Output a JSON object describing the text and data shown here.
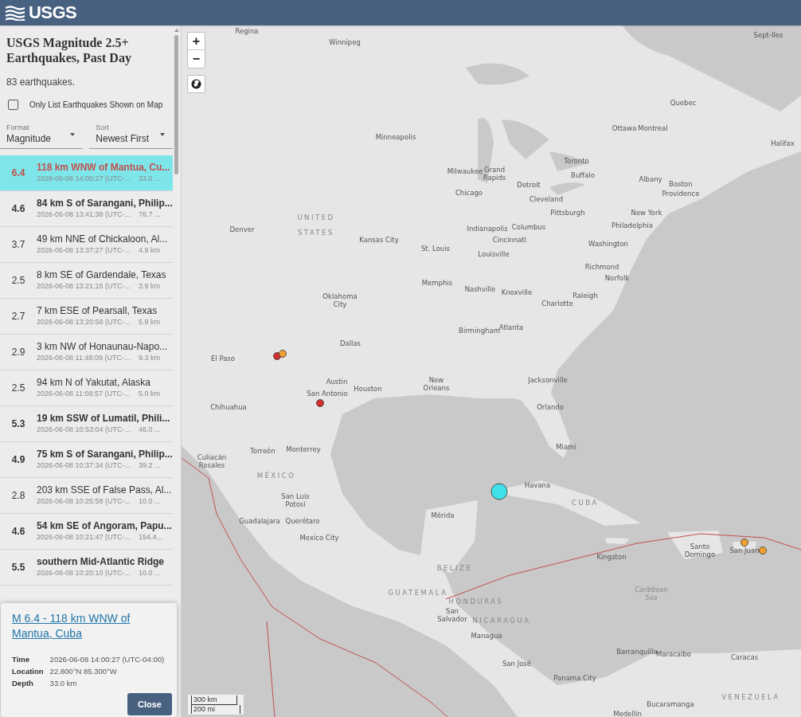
{
  "header": {
    "logo": "USGS"
  },
  "sidebar": {
    "title": "USGS Magnitude 2.5+ Earthquakes, Past Day",
    "count": "83 earthquakes.",
    "filter": {
      "label": "Only List Earthquakes Shown on Map",
      "checked": false
    },
    "selects": [
      {
        "label": "Format",
        "value": "Magnitude"
      },
      {
        "label": "Sort",
        "value": "Newest First"
      }
    ],
    "events": [
      {
        "mag": "6.4",
        "place": "118 km WNW of Mantua, Cu...",
        "time": "2026-06-08 14:00:27 (UTC-...",
        "depth": "33.0 ...",
        "significant": true,
        "selected": true
      },
      {
        "mag": "4.6",
        "place": "84 km S of Sarangani, Philip...",
        "time": "2026-06-08 13:41:38 (UTC-...",
        "depth": "76.7 ...",
        "significant": true,
        "selected": false
      },
      {
        "mag": "3.7",
        "place": "49 km NNE of Chickaloon, Al...",
        "time": "2026-06-08 13:37:27 (UTC-...",
        "depth": "4.9 km",
        "significant": false,
        "selected": false
      },
      {
        "mag": "2.5",
        "place": "8 km SE of Gardendale, Texas",
        "time": "2026-06-08 13:21:15 (UTC-...",
        "depth": "3.9 km",
        "significant": false,
        "selected": false
      },
      {
        "mag": "2.7",
        "place": "7 km ESE of Pearsall, Texas",
        "time": "2026-06-08 13:20:58 (UTC-...",
        "depth": "5.9 km",
        "significant": false,
        "selected": false
      },
      {
        "mag": "2.9",
        "place": "3 km NW of Honaunau-Napo...",
        "time": "2026-06-08 11:48:09 (UTC-...",
        "depth": "9.3 km",
        "significant": false,
        "selected": false
      },
      {
        "mag": "2.5",
        "place": "94 km N of Yakutat, Alaska",
        "time": "2026-06-08 11:08:57 (UTC-...",
        "depth": "5.0 km",
        "significant": false,
        "selected": false
      },
      {
        "mag": "5.3",
        "place": "19 km SSW of Lumatil, Phili...",
        "time": "2026-06-08 10:53:04 (UTC-...",
        "depth": "46.0 ...",
        "significant": true,
        "selected": false
      },
      {
        "mag": "4.9",
        "place": "75 km S of Sarangani, Philip...",
        "time": "2026-06-08 10:37:34 (UTC-...",
        "depth": "39.2 ...",
        "significant": true,
        "selected": false
      },
      {
        "mag": "2.8",
        "place": "203 km SSE of False Pass, Al...",
        "time": "2026-06-08 10:25:58 (UTC-...",
        "depth": "10.0 ...",
        "significant": false,
        "selected": false
      },
      {
        "mag": "4.6",
        "place": "54 km SE of Angoram, Papu...",
        "time": "2026-06-08 10:21:47 (UTC-...",
        "depth": "154.4...",
        "significant": true,
        "selected": false
      },
      {
        "mag": "5.5",
        "place": "southern Mid-Atlantic Ridge",
        "time": "2026-06-08 10:20:10 (UTC-...",
        "depth": "10.0 ...",
        "significant": true,
        "selected": false
      }
    ]
  },
  "popup": {
    "title": "M 6.4 - 118 km WNW of Mantua, Cuba",
    "fields": [
      {
        "label": "Time",
        "value": "2026-06-08 14:00:27 (UTC-04:00)"
      },
      {
        "label": "Location",
        "value": "22.800°N 85.300°W"
      },
      {
        "label": "Depth",
        "value": "33.0 km"
      }
    ],
    "button": "Close"
  },
  "map": {
    "zoom_in": "+",
    "zoom_out": "−",
    "labels": [
      {
        "text": "Regina",
        "kind": "city"
      },
      {
        "text": "Winnipeg",
        "kind": "city"
      },
      {
        "text": "Sept-Iles",
        "kind": "city"
      },
      {
        "text": "Quebec",
        "kind": "city"
      },
      {
        "text": "Ottawa",
        "kind": "city"
      },
      {
        "text": "Montreal",
        "kind": "city"
      },
      {
        "text": "Halifax",
        "kind": "city"
      },
      {
        "text": "Minneapolis",
        "kind": "city"
      },
      {
        "text": "Toronto",
        "kind": "city"
      },
      {
        "text": "Milwaukee",
        "kind": "city"
      },
      {
        "text": "Grand",
        "kind": "city"
      },
      {
        "text": "Rapids",
        "kind": "city"
      },
      {
        "text": "Buffalo",
        "kind": "city"
      },
      {
        "text": "Albany",
        "kind": "city"
      },
      {
        "text": "Boston",
        "kind": "city"
      },
      {
        "text": "Providence",
        "kind": "city"
      },
      {
        "text": "Chicago",
        "kind": "city"
      },
      {
        "text": "Detroit",
        "kind": "city"
      },
      {
        "text": "Cleveland",
        "kind": "city"
      },
      {
        "text": "Denver",
        "kind": "city"
      },
      {
        "text": "UNITED",
        "kind": "country"
      },
      {
        "text": "STATES",
        "kind": "country"
      },
      {
        "text": "Kansas City",
        "kind": "city"
      },
      {
        "text": "Indianapolis",
        "kind": "city"
      },
      {
        "text": "Columbus",
        "kind": "city"
      },
      {
        "text": "Pittsburgh",
        "kind": "city"
      },
      {
        "text": "New York",
        "kind": "city"
      },
      {
        "text": "Philadelphia",
        "kind": "city"
      },
      {
        "text": "Cincinnati",
        "kind": "city"
      },
      {
        "text": "Washington",
        "kind": "city"
      },
      {
        "text": "St. Louis",
        "kind": "city"
      },
      {
        "text": "Louisville",
        "kind": "city"
      },
      {
        "text": "Richmond",
        "kind": "city"
      },
      {
        "text": "Norfolk",
        "kind": "city"
      },
      {
        "text": "Oklahoma",
        "kind": "city"
      },
      {
        "text": "City",
        "kind": "city"
      },
      {
        "text": "Nashville",
        "kind": "city"
      },
      {
        "text": "Knoxville",
        "kind": "city"
      },
      {
        "text": "Raleigh",
        "kind": "city"
      },
      {
        "text": "Memphis",
        "kind": "city"
      },
      {
        "text": "Charlotte",
        "kind": "city"
      },
      {
        "text": "Birmingham",
        "kind": "city"
      },
      {
        "text": "Atlanta",
        "kind": "city"
      },
      {
        "text": "Dallas",
        "kind": "city"
      },
      {
        "text": "El Paso",
        "kind": "city"
      },
      {
        "text": "Austin",
        "kind": "city"
      },
      {
        "text": "Houston",
        "kind": "city"
      },
      {
        "text": "New",
        "kind": "city"
      },
      {
        "text": "Orleans",
        "kind": "city"
      },
      {
        "text": "Jacksonville",
        "kind": "city"
      },
      {
        "text": "San Antonio",
        "kind": "city"
      },
      {
        "text": "Orlando",
        "kind": "city"
      },
      {
        "text": "Chihuahua",
        "kind": "city"
      },
      {
        "text": "Torreón",
        "kind": "city"
      },
      {
        "text": "Monterrey",
        "kind": "city"
      },
      {
        "text": "Miami",
        "kind": "city"
      },
      {
        "text": "Culiacán",
        "kind": "city"
      },
      {
        "text": "Rosales",
        "kind": "city"
      },
      {
        "text": "MÉXICO",
        "kind": "country"
      },
      {
        "text": "Havana",
        "kind": "city"
      },
      {
        "text": "CUBA",
        "kind": "country"
      },
      {
        "text": "San Luis",
        "kind": "city"
      },
      {
        "text": "Potosí",
        "kind": "city"
      },
      {
        "text": "Guadalajara",
        "kind": "city"
      },
      {
        "text": "Querétaro",
        "kind": "city"
      },
      {
        "text": "Mérida",
        "kind": "city"
      },
      {
        "text": "Santo",
        "kind": "city"
      },
      {
        "text": "Domingo",
        "kind": "city"
      },
      {
        "text": "San Juan",
        "kind": "city"
      },
      {
        "text": "Mexico City",
        "kind": "city"
      },
      {
        "text": "Kingston",
        "kind": "city"
      },
      {
        "text": "BELIZE",
        "kind": "country"
      },
      {
        "text": "Caribbean",
        "kind": "water"
      },
      {
        "text": "Sea",
        "kind": "water"
      },
      {
        "text": "GUATEMALA",
        "kind": "country"
      },
      {
        "text": "HONDURAS",
        "kind": "country"
      },
      {
        "text": "San",
        "kind": "city"
      },
      {
        "text": "Salvador",
        "kind": "city"
      },
      {
        "text": "NICARAGUA",
        "kind": "country"
      },
      {
        "text": "Managua",
        "kind": "city"
      },
      {
        "text": "Barranquilla",
        "kind": "city"
      },
      {
        "text": "Maracaibo",
        "kind": "city"
      },
      {
        "text": "Caracas",
        "kind": "city"
      },
      {
        "text": "San José",
        "kind": "city"
      },
      {
        "text": "Panama City",
        "kind": "city"
      },
      {
        "text": "VENEZUELA",
        "kind": "country"
      },
      {
        "text": "Bucaramanga",
        "kind": "city"
      },
      {
        "text": "Medellín",
        "kind": "city"
      }
    ],
    "markers": [
      {
        "color": "#d32f2f",
        "selected": false
      },
      {
        "color": "#f0a030",
        "selected": false
      },
      {
        "color": "#d32f2f",
        "selected": false
      },
      {
        "color": "#3fe0e8",
        "selected": true
      },
      {
        "color": "#f0a030",
        "selected": false
      },
      {
        "color": "#f0a030",
        "selected": false
      }
    ],
    "scale": [
      "300 km",
      "200 mi"
    ]
  }
}
